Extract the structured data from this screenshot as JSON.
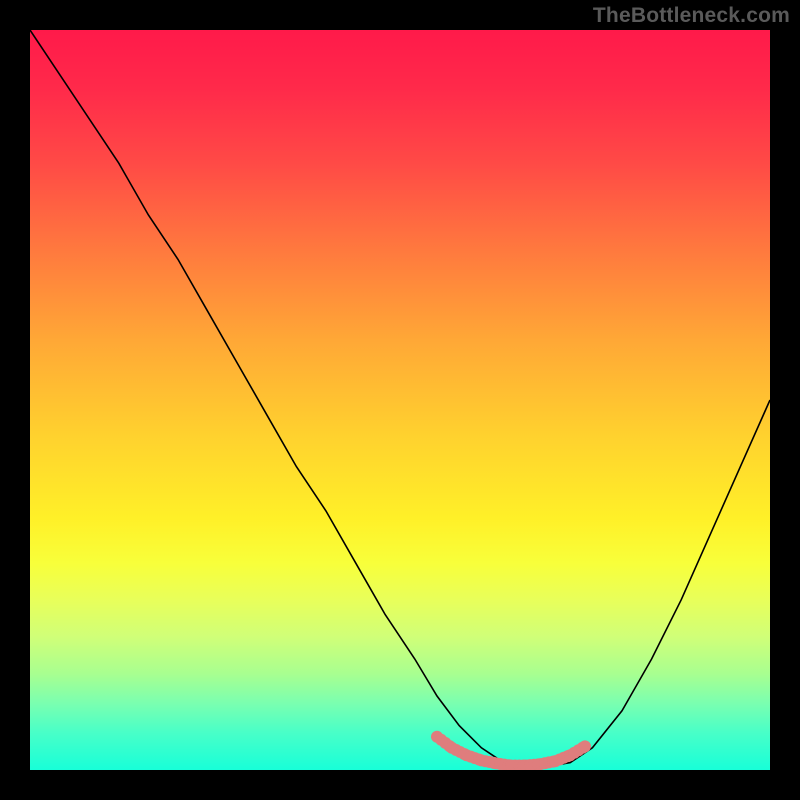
{
  "watermark": "TheBottleneck.com",
  "chart_data": {
    "type": "line",
    "title": "",
    "xlabel": "",
    "ylabel": "",
    "xlim": [
      0,
      100
    ],
    "ylim": [
      0,
      100
    ],
    "grid": false,
    "legend": false,
    "background_gradient": {
      "top_color": "#ff1a4a",
      "mid_color": "#ffd22e",
      "bottom_color": "#18ffd8"
    },
    "series": [
      {
        "name": "bottleneck-curve",
        "color": "#000000",
        "x": [
          0,
          4,
          8,
          12,
          16,
          20,
          24,
          28,
          32,
          36,
          40,
          44,
          48,
          52,
          55,
          58,
          61,
          64,
          67,
          70,
          73,
          76,
          80,
          84,
          88,
          92,
          96,
          100
        ],
        "values": [
          100,
          94,
          88,
          82,
          75,
          69,
          62,
          55,
          48,
          41,
          35,
          28,
          21,
          15,
          10,
          6,
          3,
          1,
          0.5,
          0.5,
          1,
          3,
          8,
          15,
          23,
          32,
          41,
          50
        ]
      },
      {
        "name": "flat-region-marker",
        "color": "#e07878",
        "style": "dotted-thick",
        "x": [
          55,
          57,
          59,
          61,
          63,
          65,
          67,
          69,
          71,
          73,
          75
        ],
        "values": [
          4.5,
          3.0,
          2.0,
          1.3,
          0.9,
          0.6,
          0.6,
          0.8,
          1.2,
          2.0,
          3.2
        ]
      }
    ]
  }
}
